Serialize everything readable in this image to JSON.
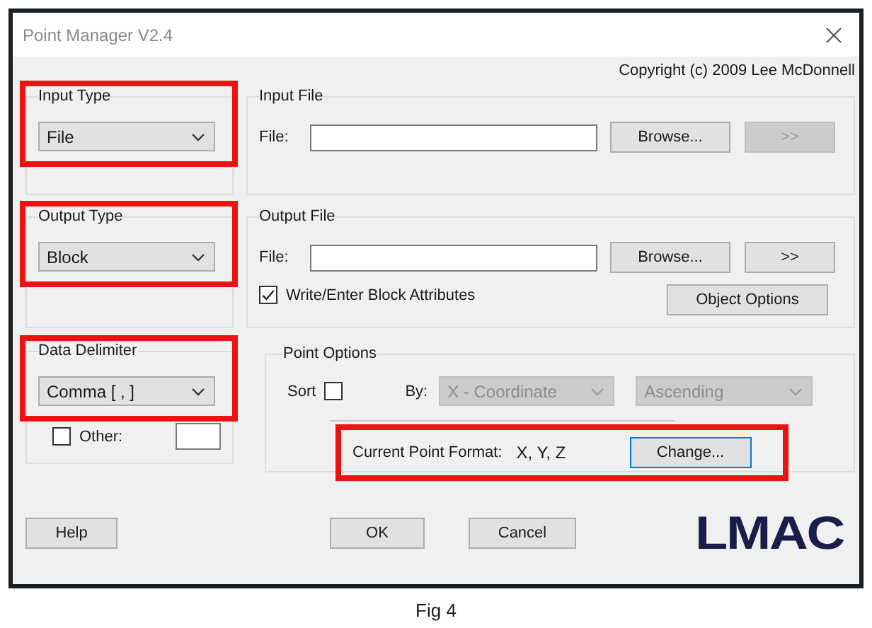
{
  "window": {
    "title": "Point Manager V2.4"
  },
  "copyright": "Copyright (c) 2009 Lee McDonnell",
  "input_type": {
    "label": "Input Type",
    "value": "File",
    "highlighted": true
  },
  "output_type": {
    "label": "Output Type",
    "value": "Block",
    "highlighted": true
  },
  "data_delimiter": {
    "label": "Data Delimiter",
    "value": "Comma [ , ]",
    "highlighted": true,
    "other_label": "Other:",
    "other_checked": false
  },
  "input_file": {
    "label": "Input File",
    "file_label": "File:",
    "browse": "Browse...",
    "next": ">>",
    "next_disabled": true
  },
  "output_file": {
    "label": "Output File",
    "file_label": "File:",
    "browse": "Browse...",
    "next": ">>",
    "next_disabled": false,
    "attributes_label": "Write/Enter Block Attributes",
    "attributes_checked": true,
    "object_options": "Object Options"
  },
  "point_options": {
    "label": "Point Options",
    "sort_label": "Sort",
    "sort_checked": false,
    "by_label": "By:",
    "by_value": "X - Coordinate",
    "order_value": "Ascending",
    "disabled": true,
    "format_label": "Current Point Format:",
    "format_value": "X, Y, Z",
    "change": "Change...",
    "highlighted": true
  },
  "buttons": [
    "Help",
    "OK",
    "Cancel"
  ],
  "logo": "LMAC",
  "caption": "Fig 4"
}
